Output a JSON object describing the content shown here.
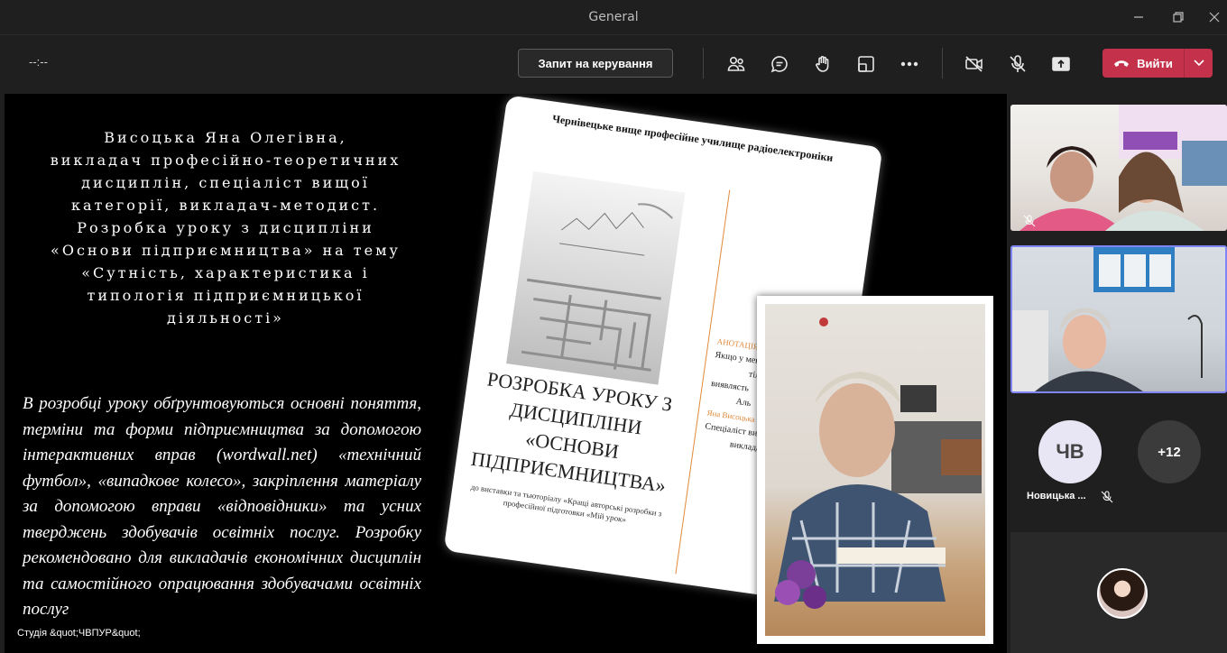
{
  "window": {
    "title": "General"
  },
  "toolbar": {
    "timer": "--:--",
    "request_control_label": "Запит на керування",
    "leave_label": "Вийти"
  },
  "slide": {
    "heading_lines": [
      "Висоцька Яна Олегівна,",
      "викладач професійно-теоретичних",
      "дисциплін, спеціаліст вищої",
      "категорії, викладач-методист.",
      "Розробка уроку з дисципліни",
      "«Основи підприємництва» на тему",
      "«Сутність, характеристика і",
      "типологія підприємницької",
      "діяльності»"
    ],
    "body": "В розробці уроку обґрунтовуються основні поняття, терміни та форми підприємництва за допомогою інтерактивних вправ (wordwall.net) «технічний футбол», «випадкове колесо», закріплення матеріалу за допомогою вправи «відповідники» та усних тверджень здобувачів освітніх послуг. Розробку рекомендовано для викладачів економічних дисциплін та самостійного опрацювання здобувачами освітніх послуг",
    "studio_label": "Студія &quot;ЧВПУР&quot;"
  },
  "booklet": {
    "college": "Чернівецьке вище професійне училище радіоелектроніки",
    "title_lines": [
      "РОЗРОБКА УРОКУ З",
      "ДИСЦИПЛІНИ",
      "«ОСНОВИ",
      "ПІДПРИЄМНИЦТВА»"
    ],
    "subtitle": "до виставки та тьюторіалу «Кращі авторські розробки з професійної підготовки «Мій урок»",
    "annotation_heading": "АНОТАЦІЯ",
    "annotation_lines": [
      "Якщо у мене",
      "тіл",
      "виявлясть",
      "",
      "Аль",
      "Яна Висоцька",
      "Спеціаліст вищ",
      "виклада"
    ]
  },
  "participants": {
    "initials_tile": {
      "initials": "ЧВ",
      "name": "Новицька ..."
    },
    "more_count": "+12"
  },
  "colors": {
    "leave": "#c4314b",
    "active_border": "#7f85f5",
    "accent_orange": "#e08a3a"
  }
}
